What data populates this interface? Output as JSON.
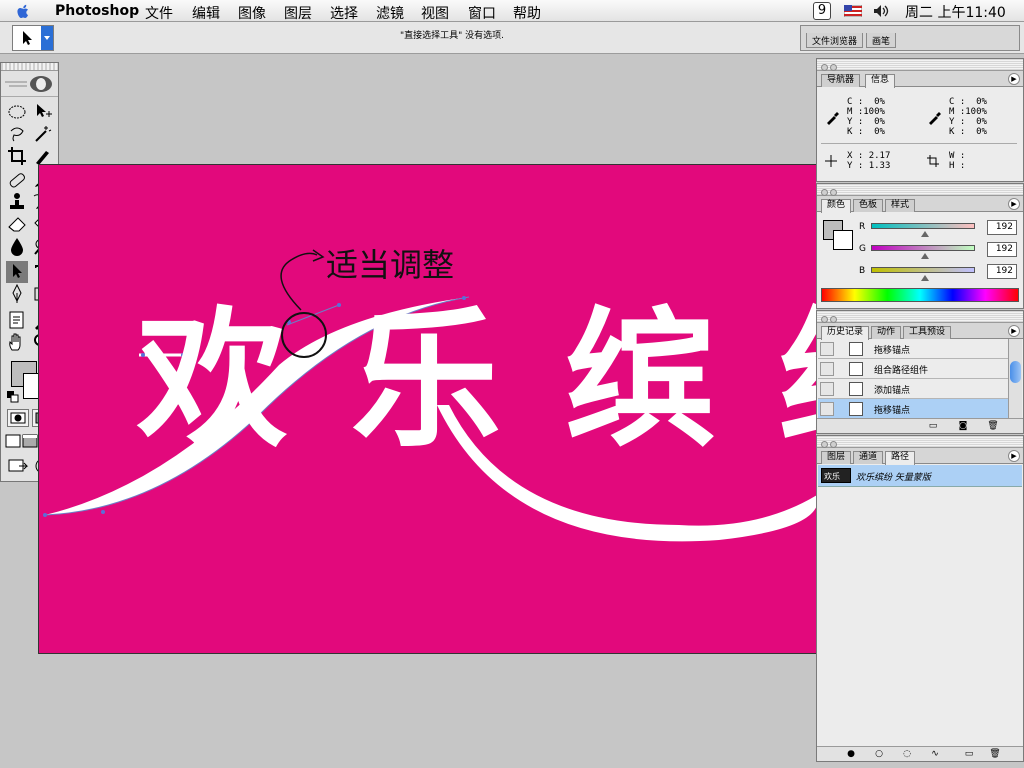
{
  "menubar": {
    "app": "Photoshop",
    "menus": [
      "文件",
      "编辑",
      "图像",
      "图层",
      "选择",
      "滤镜",
      "视图",
      "窗口",
      "帮助"
    ],
    "clock": "周二 上午11:40",
    "script_badge": "9"
  },
  "options_bar": {
    "hint": "\"直接选择工具\" 没有选项.",
    "well_tabs": [
      "文件浏览器",
      "画笔"
    ]
  },
  "document": {
    "annotation": "适当调整",
    "canvas_text": "欢乐缤纷",
    "background": "#e2097c"
  },
  "navigator_panel": {
    "tabs": [
      "导航器",
      "信息"
    ],
    "active_tab": "信息",
    "cmyk_left": {
      "C": "0%",
      "M": "100%",
      "Y": "0%",
      "K": "0%"
    },
    "cmyk_right": {
      "C": "0%",
      "M": "100%",
      "Y": "0%",
      "K": "0%"
    },
    "xy": {
      "X": "2.17",
      "Y": "1.33"
    },
    "wh": {
      "W": "",
      "H": ""
    }
  },
  "color_panel": {
    "tabs": [
      "颜色",
      "色板",
      "样式"
    ],
    "active_tab": "颜色",
    "channels": [
      {
        "label": "R",
        "value": "192"
      },
      {
        "label": "G",
        "value": "192"
      },
      {
        "label": "B",
        "value": "192"
      }
    ]
  },
  "history_panel": {
    "tabs": [
      "历史记录",
      "动作",
      "工具预设"
    ],
    "active_tab": "历史记录",
    "items": [
      "拖移锚点",
      "组合路径组件",
      "添加锚点",
      "拖移锚点"
    ],
    "active_index": 3
  },
  "layers_panel": {
    "tabs": [
      "图层",
      "通道",
      "路径"
    ],
    "active_tab": "路径",
    "path_item": "欢乐缤纷 矢量蒙版"
  }
}
